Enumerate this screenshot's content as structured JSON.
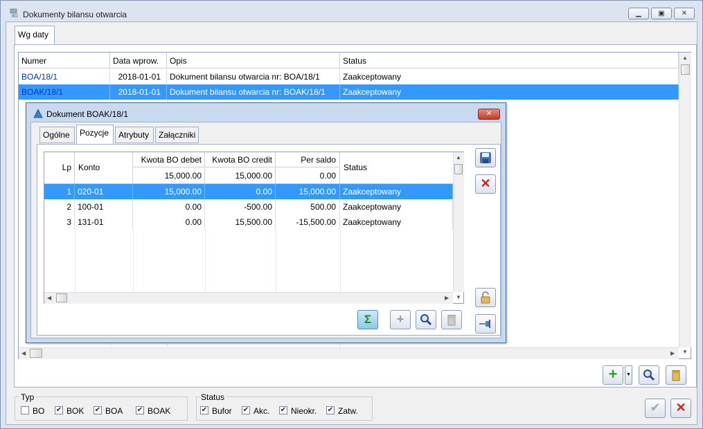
{
  "window": {
    "title": "Dokumenty bilansu otwarcia",
    "icon_text": "BO"
  },
  "main_tabs": [
    {
      "label": "Wg daty"
    }
  ],
  "list": {
    "columns": [
      "Numer",
      "Data wprow.",
      "Opis",
      "Status"
    ],
    "rows": [
      {
        "numer": "BOA/18/1",
        "data": "2018-01-01",
        "opis": "Dokument bilansu otwarcia nr: BOA/18/1",
        "status": "Zaakceptowany"
      },
      {
        "numer": "BOAK/18/1",
        "data": "2018-01-01",
        "opis": "Dokument bilansu otwarcia nr: BOAK/18/1",
        "status": "Zaakceptowany"
      }
    ]
  },
  "dialog": {
    "title": "Dokument BOAK/18/1",
    "tabs": [
      {
        "label": "Ogólne"
      },
      {
        "label": "Pozycje"
      },
      {
        "label": "Atrybuty"
      },
      {
        "label": "Załączniki"
      }
    ],
    "columns": {
      "lp": "Lp",
      "konto": "Konto",
      "debet": "Kwota BO debet",
      "credit": "Kwota BO credit",
      "saldo": "Per saldo",
      "status": "Status"
    },
    "totals": {
      "debet": "15,000.00",
      "credit": "15,000.00",
      "saldo": "0.00"
    },
    "rows": [
      {
        "lp": "1",
        "konto": "020-01",
        "debet": "15,000.00",
        "credit": "0.00",
        "saldo": "15,000.00",
        "status": "Zaakceptowany"
      },
      {
        "lp": "2",
        "konto": "100-01",
        "debet": "0.00",
        "credit": "-500.00",
        "saldo": "500.00",
        "status": "Zaakceptowany"
      },
      {
        "lp": "3",
        "konto": "131-01",
        "debet": "0.00",
        "credit": "15,500.00",
        "saldo": "-15,500.00",
        "status": "Zaakceptowany"
      }
    ],
    "side_buttons": [
      "save-icon",
      "close-icon",
      "lock-icon",
      "pin-icon"
    ],
    "bottom_buttons": [
      "sigma-icon",
      "plus-icon",
      "magnifier-icon",
      "trash-icon"
    ]
  },
  "toolbar": {
    "buttons": [
      "add-icon",
      "dropdown-arrow-icon",
      "magnifier-icon",
      "trash-icon"
    ]
  },
  "filters": {
    "typ": {
      "label": "Typ",
      "items": [
        {
          "label": "BO",
          "checked": false
        },
        {
          "label": "BOK",
          "checked": true
        },
        {
          "label": "BOA",
          "checked": true
        },
        {
          "label": "BOAK",
          "checked": true
        }
      ]
    },
    "status": {
      "label": "Status",
      "items": [
        {
          "label": "Bufor",
          "checked": true
        },
        {
          "label": "Akc.",
          "checked": true
        },
        {
          "label": "Nieokr.",
          "checked": true
        },
        {
          "label": "Zatw.",
          "checked": true
        }
      ]
    }
  },
  "colors": {
    "selection": "#3399ff",
    "link": "#0033cc",
    "plus_green": "#2fa12f",
    "close_red": "#cc2222"
  }
}
